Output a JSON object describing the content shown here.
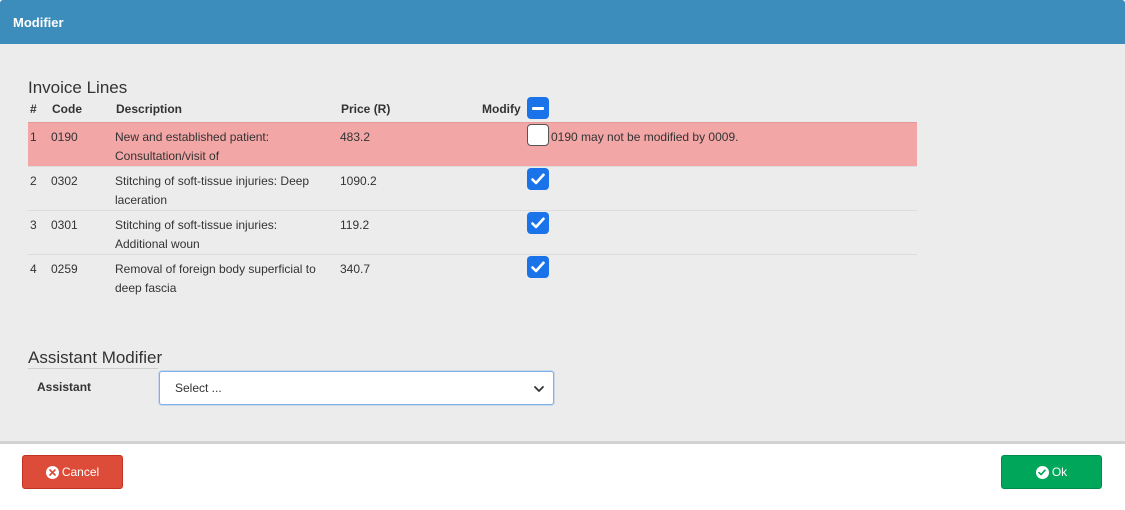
{
  "window": {
    "title": "Modifier"
  },
  "invoice": {
    "section_title": "Invoice Lines",
    "headers": {
      "num": "#",
      "code": "Code",
      "description": "Description",
      "price": "Price (R)",
      "modify": "Modify"
    },
    "rows": [
      {
        "num": "1",
        "code": "0190",
        "desc1": "New and established patient:",
        "desc2": "Consultation/visit of",
        "price": "483.2",
        "checked": false,
        "message": "0190 may not be modified by 0009."
      },
      {
        "num": "2",
        "code": "0302",
        "desc1": "Stitching of soft-tissue injuries: Deep",
        "desc2": "laceration",
        "price": "1090.2",
        "checked": true,
        "message": ""
      },
      {
        "num": "3",
        "code": "0301",
        "desc1": "Stitching of soft-tissue injuries:",
        "desc2": "Additional woun",
        "price": "119.2",
        "checked": true,
        "message": ""
      },
      {
        "num": "4",
        "code": "0259",
        "desc1": "Removal of foreign body superficial to",
        "desc2": "deep fascia",
        "price": "340.7",
        "checked": true,
        "message": ""
      }
    ]
  },
  "assistant": {
    "section_title": "Assistant Modifier",
    "label": "Assistant",
    "select_value": "Select ..."
  },
  "footer": {
    "cancel_label": "Cancel",
    "ok_label": "Ok"
  },
  "icons": {
    "cancel": "times-circle-icon",
    "ok": "check-circle-icon",
    "select": "chevron-down-icon",
    "header_checkbox": "minus-icon"
  },
  "colors": {
    "title_bar": "#3c8dbc",
    "error_row": "#f2a6a6",
    "checkbox": "#1a73e8",
    "cancel": "#dd4b39",
    "ok": "#00a65a"
  }
}
